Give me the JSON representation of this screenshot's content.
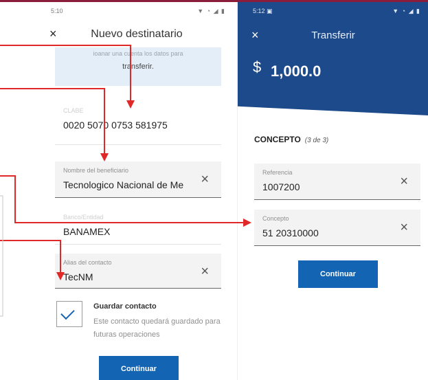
{
  "left_phone": {
    "status_time": "5:10",
    "status_icons": "▼ ◔ ◢ ▮",
    "title": "Nuevo destinatario",
    "info_line1": "ioanar una cuenta los datos para",
    "info_line2": "transferir.",
    "fields": {
      "clabe": {
        "label": "CLABE",
        "value": "0020 5070 0753 581975"
      },
      "beneficiario": {
        "label": "Nombre del beneficiario",
        "value": "Tecnologico Nacional de Me"
      },
      "banco": {
        "label": "Banco/Entidad",
        "value": "BANAMEX"
      },
      "alias": {
        "label": "Alias del contacto",
        "value": "TecNM"
      }
    },
    "guardar_title": "Guardar contacto",
    "guardar_desc": "Este contacto quedará guardado para futuras operaciones",
    "guardar_checked": true,
    "continue_label": "Continuar"
  },
  "right_phone": {
    "status_time": "5:12 ▣",
    "status_icons": "▼ ◔ ◢ ▮",
    "title": "Transferir",
    "currency": "$",
    "amount": "1,000.0",
    "concepto_heading": "CONCEPTO",
    "concepto_step": "(3 de 3)",
    "fields": {
      "referencia": {
        "label": "Referencia",
        "value": "1007200"
      },
      "concepto": {
        "label": "Concepto",
        "value": "51 20310000"
      }
    },
    "continue_label": "Continuar"
  },
  "icons": {
    "close": "×",
    "clear": "×"
  },
  "colors": {
    "header_blue": "#1c4a8a",
    "button_blue": "#1464b4",
    "arrow_red": "#e02828",
    "info_bg": "#e4eef9",
    "accent_strip": "#8a1c3c"
  }
}
